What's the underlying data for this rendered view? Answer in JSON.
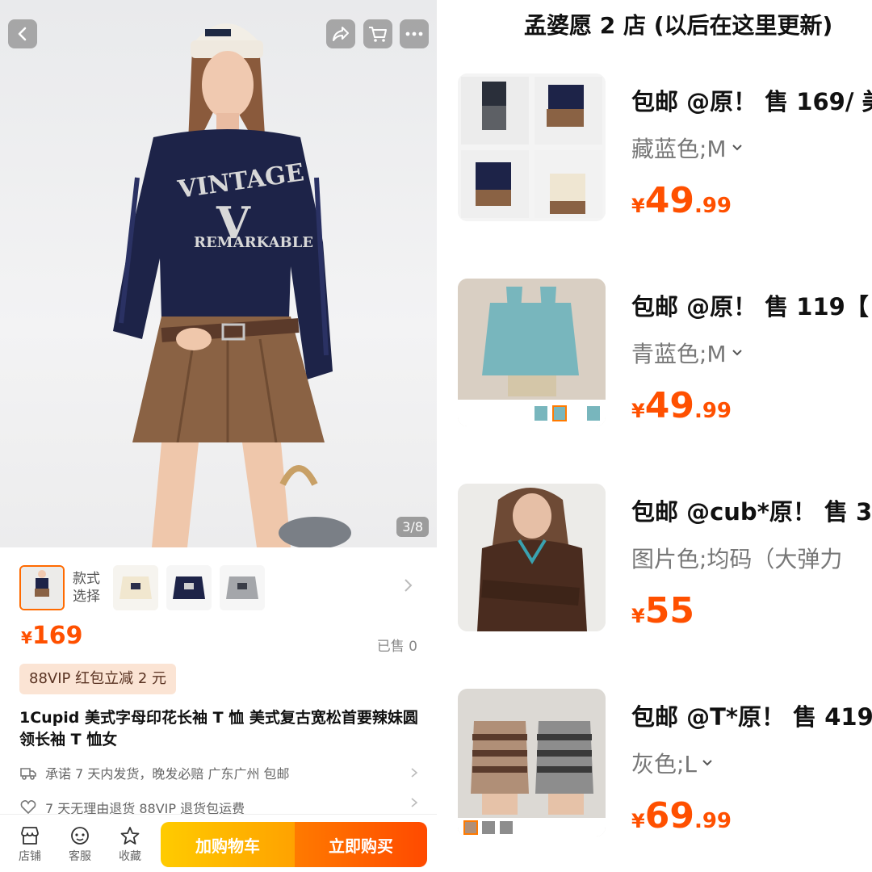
{
  "product": {
    "image_counter": "3/8",
    "style_label_line1": "款式",
    "style_label_line2": "选择",
    "price_symbol": "¥",
    "price": "169",
    "sold": "已售 0",
    "vip_badge": "88VIP 红包立减 2 元",
    "title": "1Cupid 美式字母印花长袖 T 恤 美式复古宽松首要辣妹圆领长袖 T 恤女",
    "shipping": "承诺 7 天内发货，晚发必赔  广东广州  包邮",
    "returns": "7 天无理由退货  88VIP 退货包运费",
    "sweater_text_1": "VINTAGE",
    "sweater_text_2": "REMARKABLE"
  },
  "bottom_bar": {
    "store": "店铺",
    "service": "客服",
    "favorite": "收藏",
    "add_to_cart": "加购物车",
    "buy_now": "立即购买"
  },
  "shop": {
    "title": "孟婆愿 2 店 (以后在这里更新)",
    "items": [
      {
        "name": "包邮 @原！ 售 169/ 美",
        "sku": "藏蓝色;M",
        "price_int": "49",
        "price_dec": ".99"
      },
      {
        "name": "包邮 @原！ 售 119【",
        "sku": "青蓝色;M",
        "price_int": "49",
        "price_dec": ".99"
      },
      {
        "name": "包邮 @cub*原！ 售 3",
        "sku": "图片色;均码（大弹力",
        "price_int": "55",
        "price_dec": ""
      },
      {
        "name": "包邮 @T*原！ 售 419",
        "sku": "灰色;L",
        "price_int": "69",
        "price_dec": ".99"
      }
    ]
  },
  "colors": {
    "accent": "#ff5000",
    "cart_button": "#ffb300",
    "buy_button": "#ff5a00",
    "vip_badge_bg": "#fbe4d4"
  }
}
